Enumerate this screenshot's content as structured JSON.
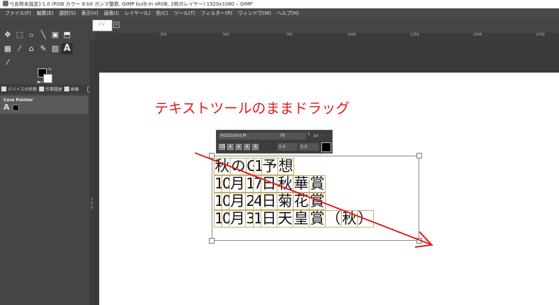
{
  "window": {
    "title": "*[名称未設定]-1.0 (RGB カラー 8 bit ガンマ整数, GIMP built-in sRGB, 2枚のレイヤー) 1920x1080 – GIMP"
  },
  "menu": {
    "items": [
      "ファイル(F)",
      "編集(E)",
      "選択(S)",
      "表示(V)",
      "画像(I)",
      "レイヤー(L)",
      "色(C)",
      "ツール(T)",
      "フィルター(R)",
      "ウィンドウ(W)",
      "ヘルプ(H)"
    ]
  },
  "image_tab": {
    "thumb_label": "ﾃﾞﾊﾞ"
  },
  "toolbox": {
    "row1": [
      "✥",
      "⬚",
      "ဝ",
      "╲",
      "▣",
      "⬒"
    ],
    "row2": [
      "▦",
      "⁄",
      "⌂",
      "✎",
      "▨",
      "A"
    ],
    "row3": [
      "⁄"
    ],
    "swap_icon": "↷",
    "default_icon": "▪▫"
  },
  "dock": {
    "tabs": [
      "デバイスの状態",
      "作業履歴",
      "画像"
    ],
    "device_name": "Core Pointer",
    "device_tool_icon": "A"
  },
  "ruler": {
    "top_labels": [
      "250",
      "500",
      "750",
      "1000",
      "1250",
      "1500",
      "1750"
    ],
    "left_labels": [
      "2",
      "5",
      "0"
    ]
  },
  "annotation": {
    "text": "テキストツールのままドラッグ",
    "color": "#e01b1b"
  },
  "text_toolbar": {
    "font": "HGSGothicM",
    "size": "78",
    "unit": "px",
    "spin": "⇕",
    "caret": "⌄",
    "buttons": [
      "⌫",
      "A",
      "A",
      "A",
      "A"
    ],
    "baseline": "0.0",
    "kerning": "0.0",
    "color": "#000000"
  },
  "text_lines": [
    [
      "秋",
      "の",
      "G",
      "1",
      "予",
      "想"
    ],
    [
      "1",
      "0",
      "月",
      "1",
      "7",
      "日",
      "秋",
      "華",
      "賞"
    ],
    [
      "1",
      "0",
      "月",
      "2",
      "4",
      "日",
      "菊",
      "花",
      "賞"
    ],
    [
      "1",
      "0",
      "月",
      "3",
      "1",
      "日",
      "天",
      "皇",
      "賞",
      "（",
      "秋",
      "）"
    ]
  ]
}
